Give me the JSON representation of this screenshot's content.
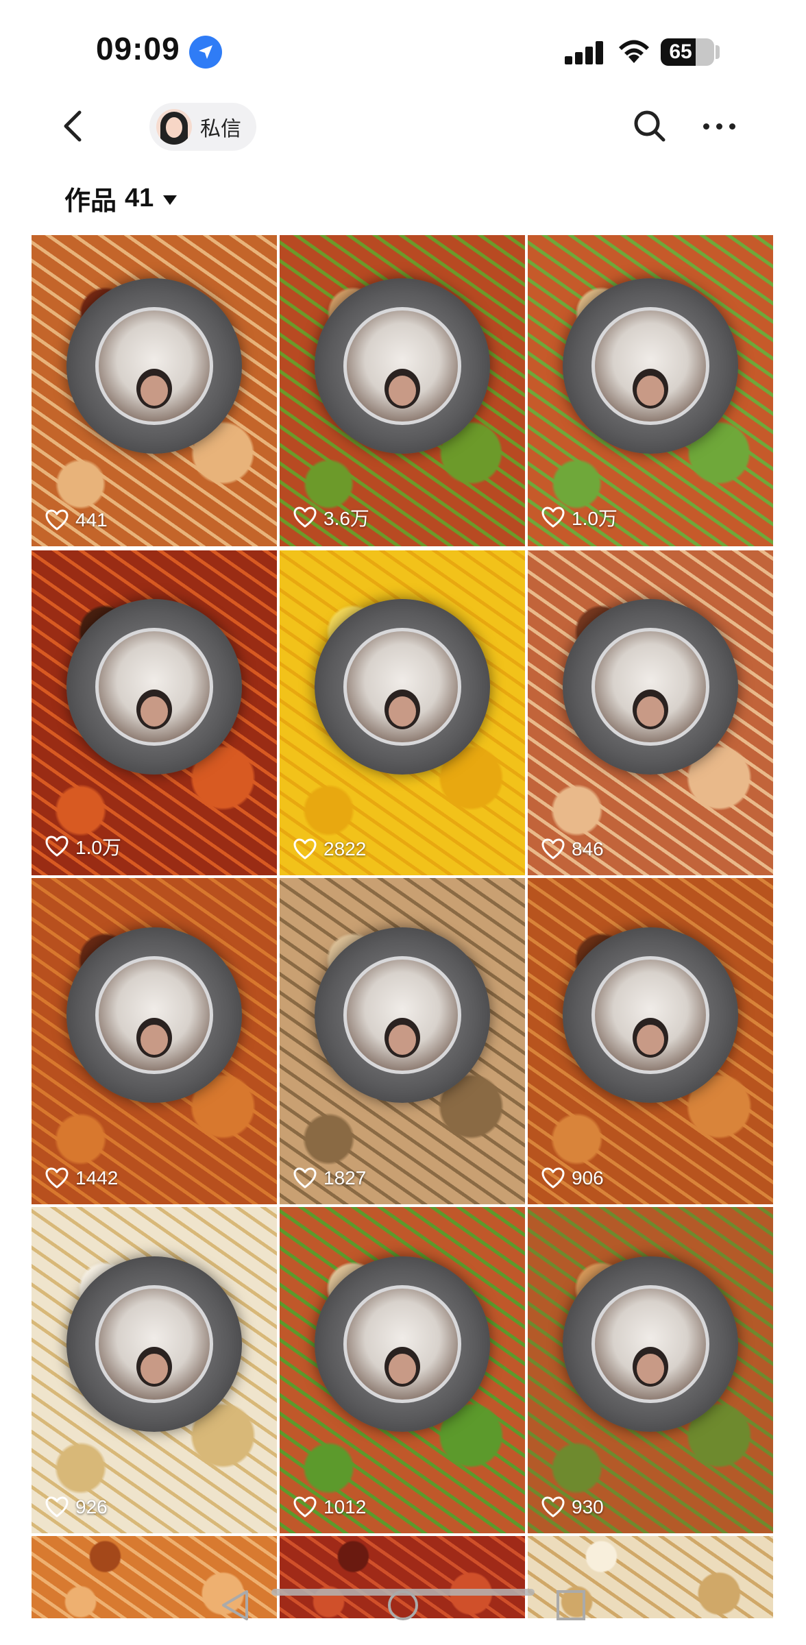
{
  "status": {
    "time": "09:09",
    "battery": "65",
    "battery_level": 0.65
  },
  "nav": {
    "dm_label": "私信"
  },
  "works": {
    "label": "作品",
    "count": "41"
  },
  "colors": {
    "accent_location": "#2f7cf6",
    "text": "#111111",
    "pill_bg": "#f1f1f3"
  },
  "videos": [
    {
      "likes": "441",
      "theme": "noodles-chili"
    },
    {
      "likes": "3.6万",
      "theme": "peppers-chopsticks"
    },
    {
      "likes": "1.0万",
      "theme": "noodles-green"
    },
    {
      "likes": "1.0万",
      "theme": "chili-oil"
    },
    {
      "likes": "2822",
      "theme": "corn"
    },
    {
      "likes": "846",
      "theme": "sausage-noodles"
    },
    {
      "likes": "1442",
      "theme": "spicy-noodles"
    },
    {
      "likes": "1827",
      "theme": "fried-rice"
    },
    {
      "likes": "906",
      "theme": "spaghetti"
    },
    {
      "likes": "926",
      "theme": "pasta-cream"
    },
    {
      "likes": "1012",
      "theme": "peppers-noodles"
    },
    {
      "likes": "930",
      "theme": "mixed-veg"
    },
    {
      "likes": "",
      "theme": "carrot"
    },
    {
      "likes": "",
      "theme": "red-oil"
    },
    {
      "likes": "",
      "theme": "cream-noodles"
    }
  ]
}
